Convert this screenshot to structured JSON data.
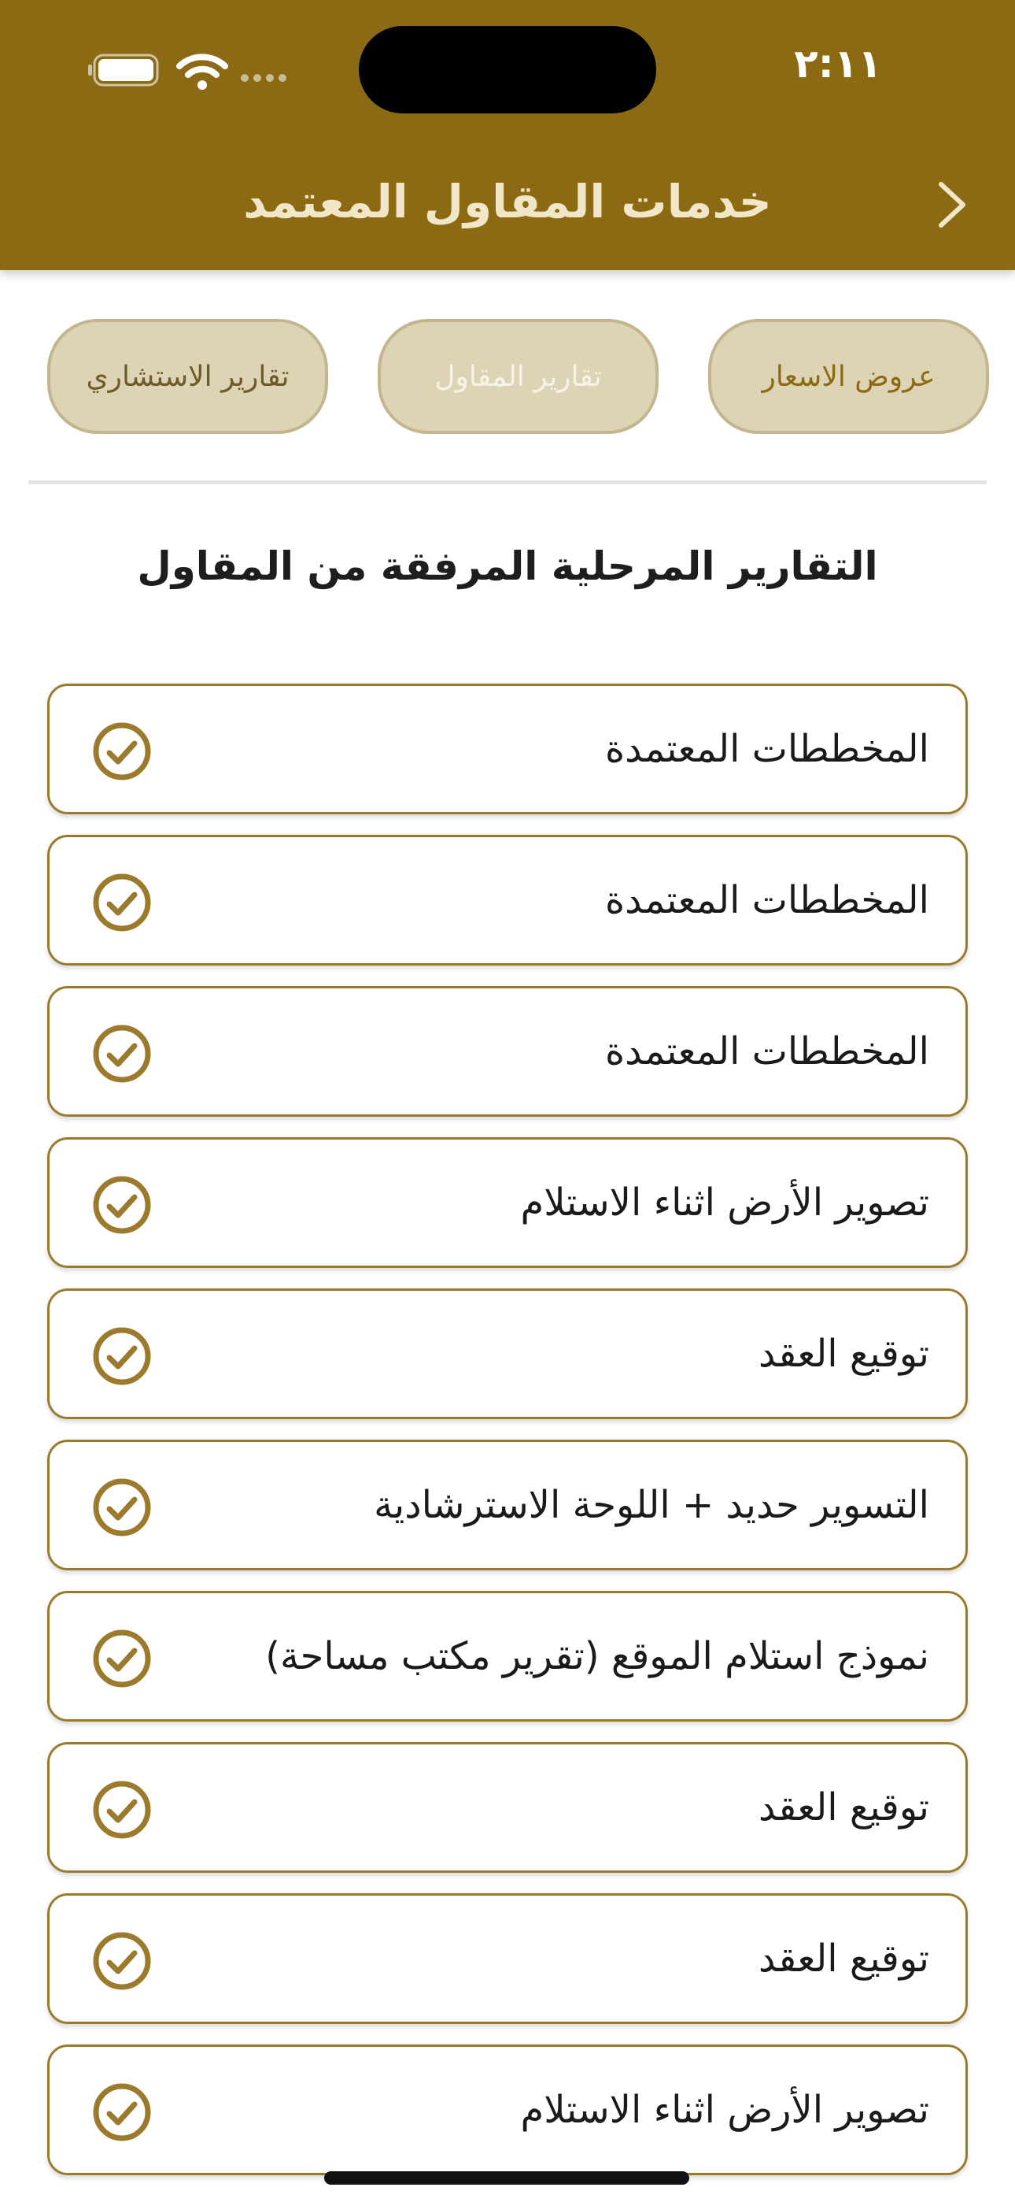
{
  "status_bar": {
    "time": "٢:١١"
  },
  "header": {
    "title": "خدمات المقاول المعتمد",
    "background": "#8b6a13"
  },
  "tabs": [
    {
      "label": "عروض الاسعار"
    },
    {
      "label": "تقارير المقاول"
    },
    {
      "label": "تقارير الاستشاري"
    }
  ],
  "section": {
    "title": "التقارير المرحلية المرفقة من المقاول"
  },
  "items": [
    {
      "label": "المخططات المعتمدة",
      "icon": "check-circle-icon"
    },
    {
      "label": "المخططات المعتمدة",
      "icon": "check-circle-icon"
    },
    {
      "label": "المخططات المعتمدة",
      "icon": "check-circle-icon"
    },
    {
      "label": "تصوير الأرض اثناء الاستلام",
      "icon": "check-circle-icon"
    },
    {
      "label": "توقيع العقد",
      "icon": "check-circle-icon"
    },
    {
      "label": "التسوير حديد + اللوحة الاسترشادية",
      "icon": "check-circle-icon"
    },
    {
      "label": "نموذج استلام الموقع (تقرير مكتب مساحة)",
      "icon": "check-circle-icon"
    },
    {
      "label": "توقيع العقد",
      "icon": "check-circle-icon"
    },
    {
      "label": "توقيع العقد",
      "icon": "check-circle-icon"
    },
    {
      "label": "تصوير الأرض اثناء الاستلام",
      "icon": "check-circle-icon"
    }
  ],
  "colors": {
    "accent": "#8b6a13",
    "tab_fill": "#ddd3b5",
    "icon": "#9c7a2c"
  }
}
